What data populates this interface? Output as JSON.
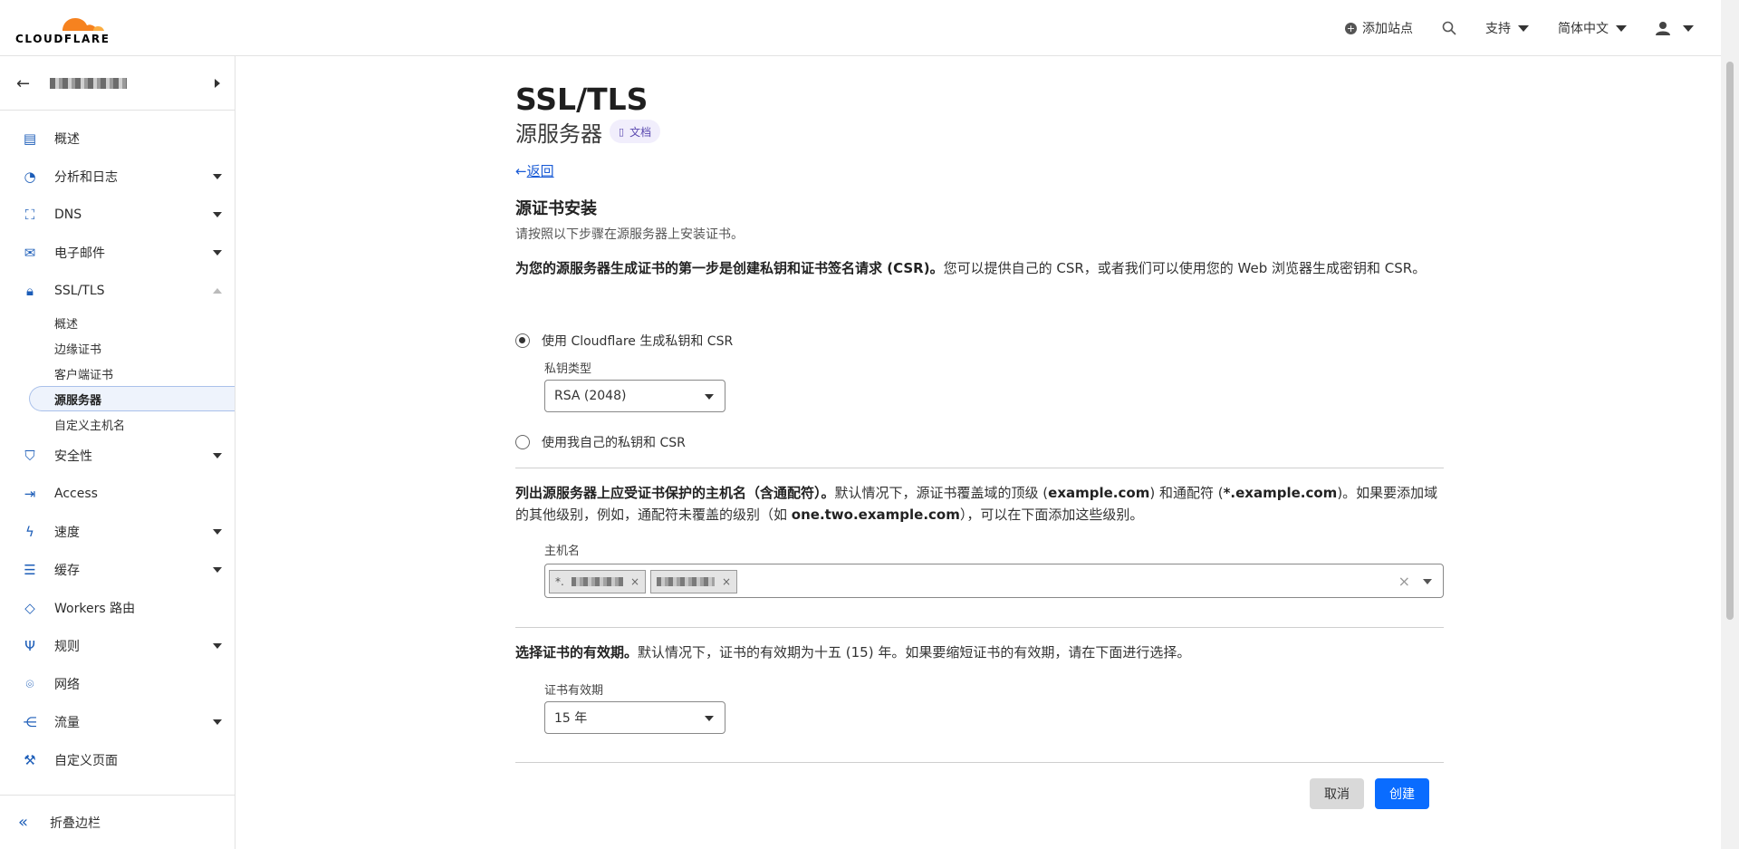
{
  "header": {
    "logo_text": "CLOUDFLARE",
    "add_site": "添加站点",
    "support": "支持",
    "language": "简体中文"
  },
  "sidebar": {
    "items": [
      {
        "label": "概述",
        "icon": "document-icon"
      },
      {
        "label": "分析和日志",
        "icon": "chart-icon",
        "dropdown": true
      },
      {
        "label": "DNS",
        "icon": "network-icon",
        "dropdown": true
      },
      {
        "label": "电子邮件",
        "icon": "email-icon",
        "dropdown": true
      },
      {
        "label": "SSL/TLS",
        "icon": "lock-icon",
        "expanded": true
      }
    ],
    "ssl_sub": [
      "概述",
      "边缘证书",
      "客户端证书",
      "源服务器",
      "自定义主机名"
    ],
    "active_sub": "源服务器",
    "items_after": [
      {
        "label": "安全性",
        "icon": "shield-icon",
        "dropdown": true
      },
      {
        "label": "Access",
        "icon": "access-icon"
      },
      {
        "label": "速度",
        "icon": "bolt-icon",
        "dropdown": true
      },
      {
        "label": "缓存",
        "icon": "cache-icon",
        "dropdown": true
      },
      {
        "label": "Workers 路由",
        "icon": "workers-icon"
      },
      {
        "label": "规则",
        "icon": "rules-icon",
        "dropdown": true
      },
      {
        "label": "网络",
        "icon": "location-icon"
      },
      {
        "label": "流量",
        "icon": "traffic-icon",
        "dropdown": true
      },
      {
        "label": "自定义页面",
        "icon": "wrench-icon"
      }
    ],
    "collapse": "折叠边栏"
  },
  "main": {
    "title": "SSL/TLS",
    "subtitle": "源服务器",
    "docs": "文档",
    "back": "返回",
    "section_title": "源证书安装",
    "section_desc": "请按照以下步骤在源服务器上安装证书。",
    "csr_bold": "为您的源服务器生成证书的第一步是创建私钥和证书签名请求 (CSR)。",
    "csr_text": "您可以提供自己的 CSR，或者我们可以使用您的 Web 浏览器生成密钥和 CSR。",
    "radio1": "使用 Cloudflare 生成私钥和 CSR",
    "key_type_label": "私钥类型",
    "key_type_value": "RSA (2048)",
    "radio2": "使用我自己的私钥和 CSR",
    "host_bold": "列出源服务器上应受证书保护的主机名（含通配符）。",
    "host_text1": "默认情况下，源证书覆盖域的顶级 (",
    "host_ex1": "example.com",
    "host_text2": ") 和通配符 (",
    "host_ex2": "*.example.com",
    "host_text3": ")。如果要添加域的其他级别，例如，通配符未覆盖的级别（如 ",
    "host_ex3": "one.two.example.com",
    "host_text4": "），可以在下面添加这些级别。",
    "hostname_label": "主机名",
    "tag_prefix": "*.",
    "tag_close": "×",
    "clear_icon": "×",
    "validity_bold": "选择证书的有效期。",
    "validity_text": "默认情况下，证书的有效期为十五 (15) 年。如果要缩短证书的有效期，请在下面进行选择。",
    "validity_label": "证书有效期",
    "validity_value": "15 年",
    "cancel": "取消",
    "create": "创建"
  }
}
